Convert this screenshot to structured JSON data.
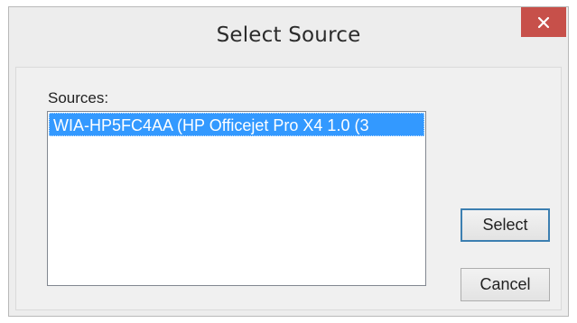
{
  "dialog": {
    "title": "Select Source"
  },
  "sources": {
    "label": "Sources:",
    "items": [
      {
        "label": "WIA-HP5FC4AA (HP Officejet Pro X4 1.0 (3",
        "selected": true
      }
    ]
  },
  "buttons": {
    "select_label": "Select",
    "cancel_label": "Cancel"
  },
  "colors": {
    "close_button": "#c7504a",
    "selection_highlight": "#3399ff",
    "default_button_border": "#3c7fb1"
  },
  "icons": {
    "close": "close-icon"
  }
}
